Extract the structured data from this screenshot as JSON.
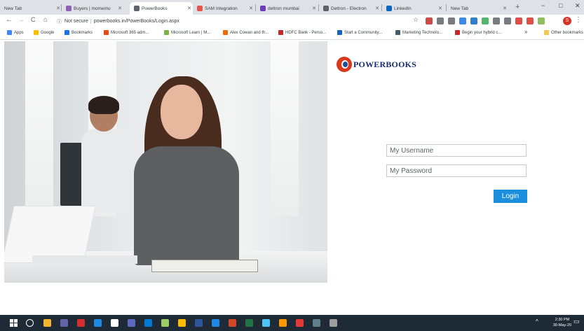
{
  "browser": {
    "tabs": [
      {
        "title": "New Tab",
        "icon": "new-tab-icon",
        "color": "#dee1e6",
        "active": false
      },
      {
        "title": "Buyers | momemu",
        "icon": "buyers-site-icon",
        "color": "#8e5fb5",
        "active": false
      },
      {
        "title": "PowerBooks",
        "icon": "globe-icon",
        "color": "#5f6368",
        "active": true
      },
      {
        "title": "SAM Integration",
        "icon": "sam-icon",
        "color": "#e8534a",
        "active": false
      },
      {
        "title": "deltron mumbai",
        "icon": "deltron-icon",
        "color": "#6a3dba",
        "active": false
      },
      {
        "title": "Deltron - Electron",
        "icon": "globe-icon",
        "color": "#5f6368",
        "active": false
      },
      {
        "title": "LinkedIn",
        "icon": "linkedin-icon",
        "color": "#0a66c2",
        "active": false
      },
      {
        "title": "New Tab",
        "icon": "new-tab-icon",
        "color": "#dee1e6",
        "active": false
      }
    ],
    "new_tab_glyph": "+",
    "window_controls": {
      "minimize": "−",
      "maximize": "□",
      "close": "✕"
    },
    "nav": {
      "back": "←",
      "forward": "→",
      "reload": "C",
      "home": "⌂"
    },
    "address": {
      "security_label": "Not secure",
      "separator": "|",
      "url": "powerbooks.in/PowerBooks/Login.aspx",
      "star": "☆"
    },
    "extensions": [
      {
        "icon": "pdf-extension-icon",
        "color": "#c62828"
      },
      {
        "icon": "circle-extension-icon",
        "color": "#5f6368"
      },
      {
        "icon": "s-extension-icon",
        "color": "#5f6368"
      },
      {
        "icon": "blue-extension-icon",
        "color": "#1a73e8"
      },
      {
        "icon": "linkedin-extension-icon",
        "color": "#0a66c2"
      },
      {
        "icon": "green-extension-icon",
        "color": "#34a853"
      },
      {
        "icon": "monitor-extension-icon",
        "color": "#5f6368"
      },
      {
        "icon": "search-extension-icon",
        "color": "#5f6368"
      },
      {
        "icon": "pin-extension-icon",
        "color": "#d93025"
      },
      {
        "icon": "red-extension-icon",
        "color": "#d93025"
      },
      {
        "icon": "puzzle-extension-icon",
        "color": "#7cb342"
      }
    ],
    "profile_initial": "S",
    "menu_glyph": "⋮",
    "bookmarks": [
      {
        "label": "Apps",
        "color": "#4285f4"
      },
      {
        "label": "Google",
        "color": "#fbbc05"
      },
      {
        "label": "Bookmarks",
        "color": "#1a73e8"
      },
      {
        "label": "Microsoft 365 adm...",
        "color": "#e64a19"
      },
      {
        "label": "Microsoft Learn | M...",
        "color": "#7cb342"
      },
      {
        "label": "Alex Cowan and th...",
        "color": "#ef6c00"
      },
      {
        "label": "HDFC Bank - Perso...",
        "color": "#c62828"
      },
      {
        "label": "Start a Community...",
        "color": "#1565c0"
      },
      {
        "label": "Marketing Technolo...",
        "color": "#455a64"
      },
      {
        "label": "Begin your hybrid c...",
        "color": "#c62828"
      }
    ],
    "bookmarks_overflow": "»",
    "other_bookmarks": "Other bookmarks"
  },
  "login": {
    "logo_text": "POWERBOOKS",
    "username_placeholder": "My Username",
    "password_placeholder": "My Password",
    "submit_label": "Login"
  },
  "taskbar": {
    "apps": [
      {
        "icon": "file-explorer-icon",
        "color": "#f2b632"
      },
      {
        "icon": "teams-icon",
        "color": "#6264a7"
      },
      {
        "icon": "pdf-reader-icon",
        "color": "#d32f2f"
      },
      {
        "icon": "snipping-tool-icon",
        "color": "#1e88e5"
      },
      {
        "icon": "store-icon",
        "color": "#ffffff"
      },
      {
        "icon": "chat-icon",
        "color": "#5c6bc0"
      },
      {
        "icon": "mail-icon",
        "color": "#0078d4"
      },
      {
        "icon": "excel-tool-icon",
        "color": "#9ccc65"
      },
      {
        "icon": "chrome-icon",
        "color": "#fbbc05"
      },
      {
        "icon": "word-icon",
        "color": "#2b579a"
      },
      {
        "icon": "remote-desktop-icon",
        "color": "#1e88e5"
      },
      {
        "icon": "powerpoint-icon",
        "color": "#d24726"
      },
      {
        "icon": "excel-icon",
        "color": "#217346"
      },
      {
        "icon": "maps-icon",
        "color": "#4fc3f7"
      },
      {
        "icon": "firefox-icon",
        "color": "#ff9800"
      },
      {
        "icon": "opera-icon",
        "color": "#e53935"
      },
      {
        "icon": "calculator-icon",
        "color": "#607d8b"
      },
      {
        "icon": "pen-icon",
        "color": "#9e9e9e"
      }
    ],
    "tray_chevron": "^",
    "time": "2:30 PM",
    "date": "30-May-20",
    "notification_glyph": "▭"
  }
}
